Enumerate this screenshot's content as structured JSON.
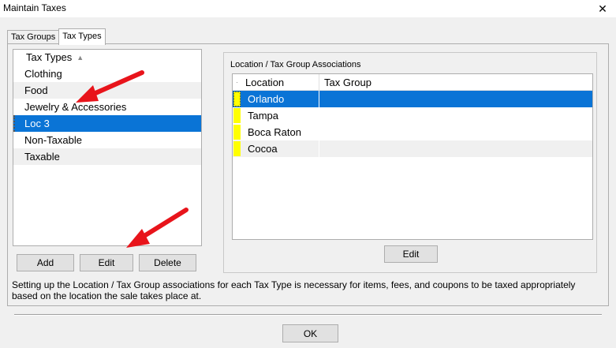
{
  "window": {
    "title": "Maintain Taxes"
  },
  "tabs": [
    {
      "label": "Tax Groups",
      "active": false
    },
    {
      "label": "Tax Types",
      "active": true
    }
  ],
  "tax_types": {
    "header": "Tax Types",
    "items": [
      {
        "label": "Clothing"
      },
      {
        "label": "Food"
      },
      {
        "label": "Jewelry & Accessories"
      },
      {
        "label": "Loc 3"
      },
      {
        "label": "Non-Taxable"
      },
      {
        "label": "Taxable"
      }
    ],
    "selected_index": 3,
    "add_label": "Add",
    "edit_label": "Edit",
    "delete_label": "Delete"
  },
  "associations": {
    "group_label": "Location / Tax Group Associations",
    "columns": [
      "Location",
      "Tax Group"
    ],
    "rows": [
      {
        "location": "Orlando",
        "tax_group": ""
      },
      {
        "location": "Tampa",
        "tax_group": ""
      },
      {
        "location": "Boca Raton",
        "tax_group": ""
      },
      {
        "location": "Cocoa",
        "tax_group": ""
      }
    ],
    "selected_index": 0,
    "edit_label": "Edit"
  },
  "help_text": "Setting up the Location / Tax Group associations for each Tax Type is necessary for items, fees, and coupons to be taxed appropriately based on the location the sale takes place at.",
  "ok_label": "OK",
  "colors": {
    "selection": "#0a74d6",
    "marker": "#ffff00",
    "arrow": "#e8141b"
  }
}
